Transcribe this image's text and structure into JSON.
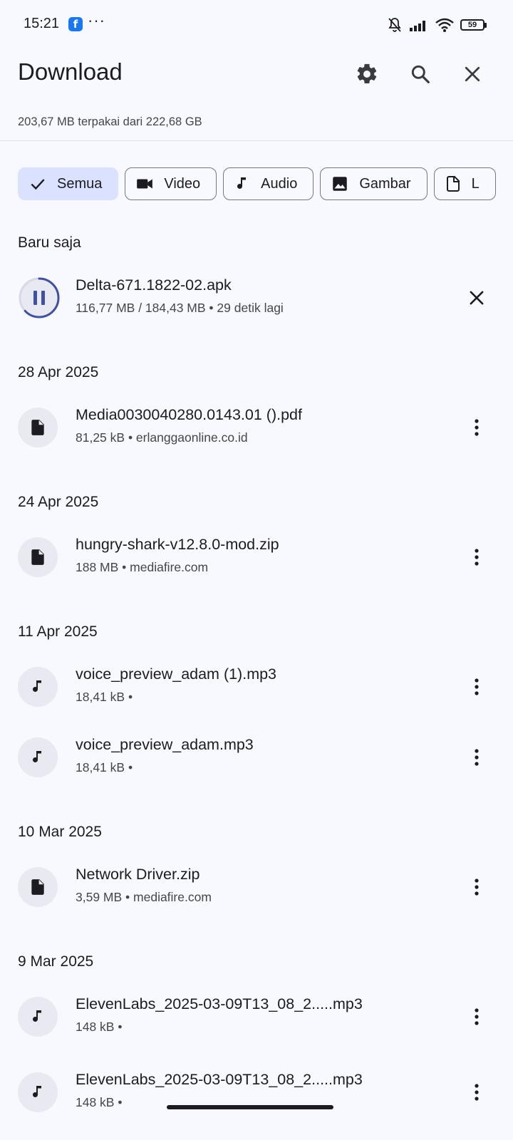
{
  "status_bar": {
    "time": "15:21",
    "notification_app": "f",
    "more_indicator": "···",
    "battery_level": "59"
  },
  "header": {
    "title": "Download",
    "storage": "203,67 MB terpakai dari 222,68 GB",
    "settings_icon": "gear-icon",
    "search_icon": "search-icon",
    "close_icon": "close-icon"
  },
  "filters": [
    {
      "label": "Semua",
      "icon": "check-icon",
      "selected": true
    },
    {
      "label": "Video",
      "icon": "video-icon",
      "selected": false
    },
    {
      "label": "Audio",
      "icon": "music-note-icon",
      "selected": false
    },
    {
      "label": "Gambar",
      "icon": "image-icon",
      "selected": false
    },
    {
      "label": "L",
      "icon": "document-icon",
      "selected": false
    }
  ],
  "sections": [
    {
      "header": "Baru saja",
      "items": [
        {
          "name": "Delta-671.1822-02.apk",
          "detail": "116,77 MB / 184,43 MB • 29 detik lagi",
          "type": "in-progress",
          "progress": 0.63,
          "action": "cancel"
        }
      ]
    },
    {
      "header": "28 Apr 2025",
      "items": [
        {
          "name": "Media0030040280.0143.01 ().pdf",
          "detail": "81,25 kB • erlanggaonline.co.id",
          "type": "document"
        }
      ]
    },
    {
      "header": "24 Apr 2025",
      "items": [
        {
          "name": "hungry-shark-v12.8.0-mod.zip",
          "detail": "188 MB • mediafire.com",
          "type": "document"
        }
      ]
    },
    {
      "header": "11 Apr 2025",
      "items": [
        {
          "name": "voice_preview_adam (1).mp3",
          "detail": "18,41 kB •",
          "type": "audio"
        },
        {
          "name": "voice_preview_adam.mp3",
          "detail": "18,41 kB •",
          "type": "audio"
        }
      ]
    },
    {
      "header": "10 Mar 2025",
      "items": [
        {
          "name": "Network Driver.zip",
          "detail": "3,59 MB • mediafire.com",
          "type": "document"
        }
      ]
    },
    {
      "header": "9 Mar 2025",
      "items": [
        {
          "name": "ElevenLabs_2025-03-09T13_08_2.....mp3",
          "detail": "148 kB •",
          "type": "audio"
        },
        {
          "name": "ElevenLabs_2025-03-09T13_08_2.....mp3",
          "detail": "148 kB •",
          "type": "audio"
        }
      ]
    }
  ]
}
